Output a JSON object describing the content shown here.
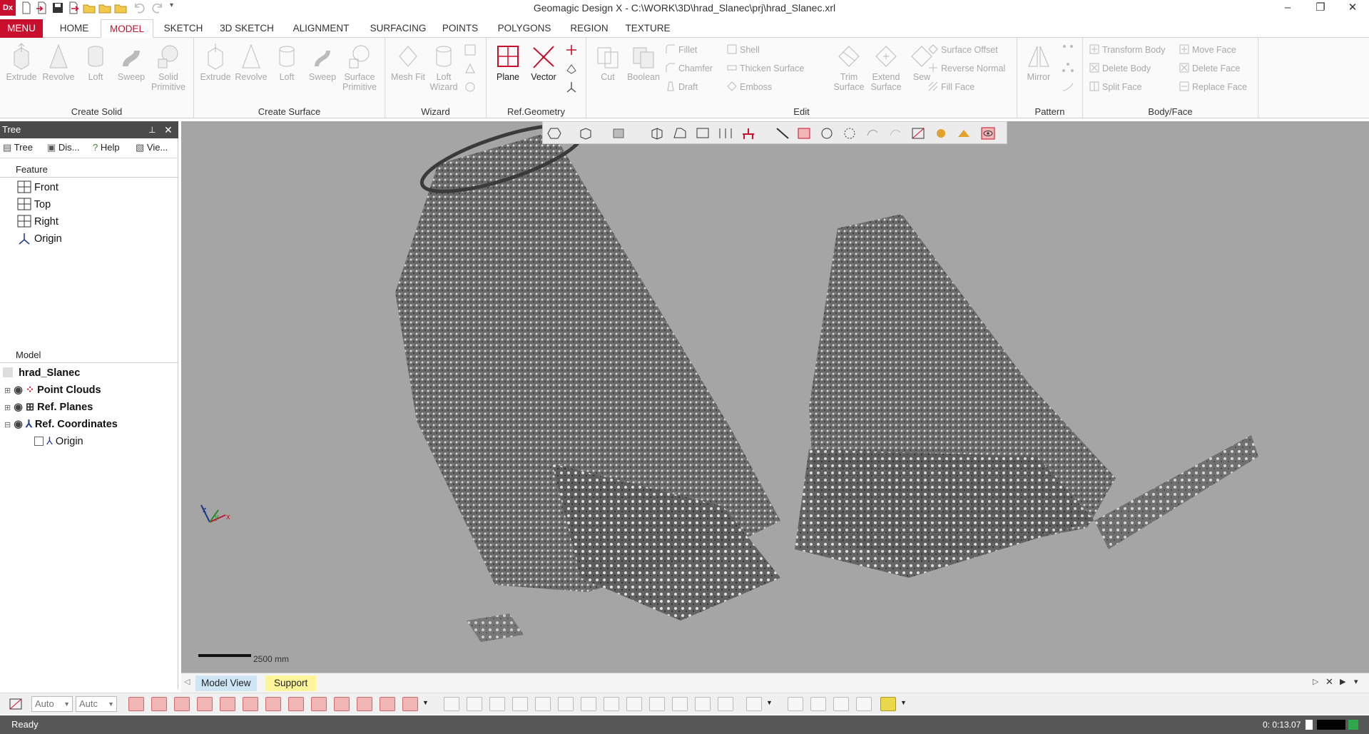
{
  "app": {
    "logo": "Dx",
    "title": "Geomagic Design X - C:\\WORK\\3D\\hrad_Slanec\\prj\\hrad_Slanec.xrl"
  },
  "window_controls": {
    "minimize": "–",
    "restore": "❐",
    "close": "✕"
  },
  "ribbon_tabs": [
    "MENU",
    "HOME",
    "MODEL",
    "SKETCH",
    "3D SKETCH",
    "ALIGNMENT",
    "SURFACING",
    "POINTS",
    "POLYGONS",
    "REGION",
    "TEXTURE"
  ],
  "ribbon": {
    "create_solid": {
      "label": "Create Solid",
      "buttons": [
        "Extrude",
        "Revolve",
        "Loft",
        "Sweep",
        "Solid Primitive"
      ]
    },
    "create_surface": {
      "label": "Create Surface",
      "buttons": [
        "Extrude",
        "Revolve",
        "Loft",
        "Sweep",
        "Surface Primitive"
      ]
    },
    "wizard": {
      "label": "Wizard",
      "buttons": [
        "Mesh Fit",
        "Loft Wizard"
      ]
    },
    "ref_geometry": {
      "label": "Ref.Geometry",
      "buttons": [
        "Plane",
        "Vector"
      ]
    },
    "edit": {
      "label": "Edit",
      "buttons": [
        "Cut",
        "Boolean",
        "Trim Surface",
        "Extend Surface",
        "Sew"
      ],
      "small": [
        "Fillet",
        "Chamfer",
        "Draft",
        "Shell",
        "Thicken Surface",
        "Emboss",
        "Surface Offset",
        "Reverse Normal",
        "Fill Face"
      ]
    },
    "pattern": {
      "label": "Pattern",
      "buttons": [
        "Mirror"
      ]
    },
    "body_face": {
      "label": "Body/Face",
      "small": [
        "Transform Body",
        "Delete Body",
        "Split Face",
        "Move Face",
        "Delete Face",
        "Replace Face"
      ]
    }
  },
  "tree_panel": {
    "title": "Tree",
    "tabs": [
      "Tree",
      "Dis...",
      "Help",
      "Vie..."
    ],
    "feature_label": "Feature",
    "features": [
      "Front",
      "Top",
      "Right",
      "Origin"
    ],
    "model_label": "Model",
    "model_root": "hrad_Slanec",
    "model_items": [
      "Point Clouds",
      "Ref. Planes",
      "Ref. Coordinates",
      "Origin"
    ]
  },
  "viewport": {
    "scale_label": "2500 mm",
    "background": "#a5a5a5"
  },
  "bottom_tabs": [
    "Model View",
    "Support"
  ],
  "bottom_toolbar": {
    "combo1": "Auto",
    "combo2": "Autc"
  },
  "status": {
    "text": "Ready",
    "timer": "0: 0:13.07"
  },
  "colors": {
    "accent": "#c8102e",
    "panel_header": "#4a4a4a",
    "status_bg": "#575757"
  }
}
